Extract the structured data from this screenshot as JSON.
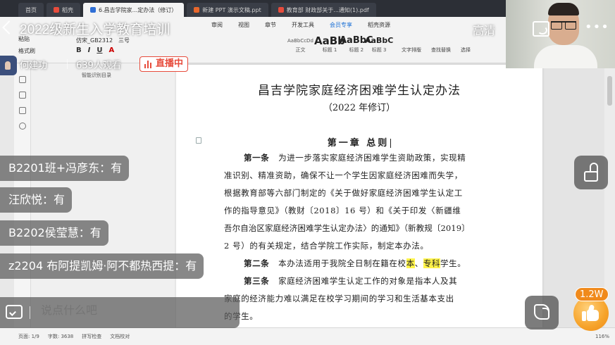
{
  "doc_app": {
    "tabs": [
      {
        "label": "首页",
        "color": "#2c2f36"
      },
      {
        "label": "稻壳",
        "color": "#e74c3c"
      },
      {
        "label": "6.昌吉学院家...定办法（修订）",
        "color": "#2f6fd6"
      },
      {
        "label": "新建 PPT 演示文稿.ppt",
        "color": "#e8672c"
      },
      {
        "label": "教育部 财政部关于...通知(1).pdf",
        "color": "#e74c3c"
      }
    ],
    "menu": [
      "审阅",
      "视图",
      "章节",
      "开发工具",
      "会员专享",
      "稻壳资源"
    ],
    "left_tools": [
      "粘贴",
      "格式刷"
    ],
    "font_name": "仿宋_GB2312",
    "font_size": "三号",
    "styles": [
      {
        "preview": "AaBbCcDd",
        "label": "正文"
      },
      {
        "preview": "AaBb",
        "label": "标题 1"
      },
      {
        "preview": "AaBbC",
        "label": "标题 2"
      },
      {
        "preview": "AaBbC",
        "label": "标题 3"
      }
    ],
    "right_tools": [
      "文字排版",
      "查找替换",
      "选择"
    ],
    "nav_label": "智能识别目录",
    "status": {
      "page": "页面: 1/9",
      "words": "字数: 3638",
      "spell": "拼写检查",
      "proof": "文档校对",
      "zoom": "116%"
    }
  },
  "document": {
    "title": "昌吉学院家庭经济困难学生认定办法",
    "subtitle": "（2022 年修订）",
    "chapter": "第一章 总则",
    "lines": [
      {
        "art": "第一条",
        "text": "为进一步落实家庭经济困难学生资助政策，实现精"
      },
      {
        "text": "准识别、精准资助，确保不让一个学生因家庭经济困难而失学，"
      },
      {
        "text": "根据教育部等六部门制定的《关于做好家庭经济困难学生认定工"
      },
      {
        "text": "作的指导意见》（教财〔2018〕16 号）和《关于印发〈新疆维"
      },
      {
        "text": "吾尔自治区家庭经济困难学生认定办法〉的通知》（新教规〔2019〕"
      },
      {
        "text": "2 号）的有关规定，结合学院工作实际，制定本办法。"
      },
      {
        "art": "第二条",
        "text_before": "本办法适用于我院全日制在籍在校",
        "hl1": "本",
        "mid": "、",
        "hl2": "专科",
        "text_after": "学生。"
      },
      {
        "art": "第三条",
        "text": "家庭经济困难学生认定工作的对象是指本人及其"
      },
      {
        "text": "家庭的经济能力难以满足在校学习期间的学习和生活基本支出"
      },
      {
        "text": "的学生。"
      }
    ]
  },
  "stream": {
    "title": "2022级新生入学教育培训",
    "quality": "高清",
    "host_name": "何建功",
    "viewers": "639人观看",
    "live_badge": "直播中",
    "live_color": "#e74c3c",
    "like_count": "1.2W",
    "like_color": "#f6a32a",
    "chat_placeholder": "说点什么吧",
    "messages": [
      "B2201班+冯彦东：有",
      "汪欣悦：有",
      "B2202侯莹慧：有",
      "z2204 布阿提凯姆·阿不都热西提：有"
    ],
    "icons": [
      "back-icon",
      "cast-icon",
      "more-icon",
      "lock-icon",
      "phone-icon",
      "like-icon",
      "chat-icon"
    ]
  }
}
